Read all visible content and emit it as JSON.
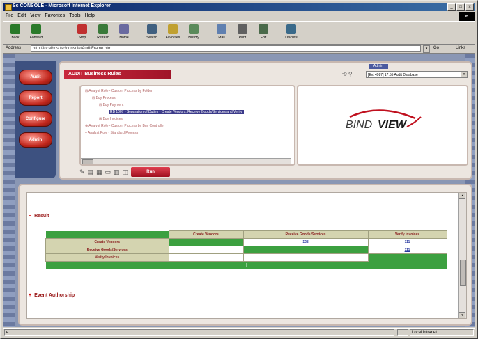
{
  "window": {
    "title": "Sc CONSOLE - Microsoft Internet Explorer",
    "minimize": "_",
    "maximize": "□",
    "close": "x"
  },
  "menu": [
    "File",
    "Edit",
    "View",
    "Favorites",
    "Tools",
    "Help"
  ],
  "throbber": "e",
  "toolbar": [
    {
      "label": "Back",
      "icon": "back-arrow-icon",
      "color": "#2a7a2a"
    },
    {
      "label": "Forward",
      "icon": "forward-arrow-icon",
      "color": "#2a7a2a"
    },
    {
      "label": "Stop",
      "icon": "stop-icon",
      "color": "#c03030"
    },
    {
      "label": "Refresh",
      "icon": "refresh-icon",
      "color": "#3a7a3a"
    },
    {
      "label": "Home",
      "icon": "home-icon",
      "color": "#6a6aa0"
    },
    {
      "label": "Search",
      "icon": "search-icon",
      "color": "#406080"
    },
    {
      "label": "Favorites",
      "icon": "favorites-icon",
      "color": "#c0a030"
    },
    {
      "label": "History",
      "icon": "history-icon",
      "color": "#5a8a5a"
    },
    {
      "label": "Mail",
      "icon": "mail-icon",
      "color": "#6080b0"
    },
    {
      "label": "Print",
      "icon": "print-icon",
      "color": "#606060"
    },
    {
      "label": "Edit",
      "icon": "edit-icon",
      "color": "#4a6a4a"
    },
    {
      "label": "Discuss",
      "icon": "discuss-icon",
      "color": "#3a6a8a"
    }
  ],
  "address": {
    "label": "Address",
    "value": "http://localhost/sc/console/AuditFrame.htm",
    "go": "Go",
    "links": "Links"
  },
  "nav": {
    "buttons": [
      "Audit",
      "Report",
      "Configure",
      "Admin"
    ]
  },
  "audit": {
    "title": "AUDIT Business Rules",
    "user_badge": "Admin",
    "session_value": "[Evt 4987] 17:55 Audit Database",
    "ctrl_icons": "⟲  ⚲"
  },
  "tree": {
    "lines": [
      "⊟  Analyst Role - Custom Process by Folder",
      "⊟  Buy Process",
      "⊟  Buy Payment",
      "RB 1007 - Separation of Duties - Create Vendors, Receive Goods/Services and Verify",
      "⊞  Buy Invoices",
      "⊕  Analyst Role - Custom Process by Buy Controller",
      "+  Analyst Role - Standard Process"
    ],
    "scroll_marker": "◂◂◂"
  },
  "logo": {
    "text_bind": "BIND",
    "text_view": "VIEW",
    "accent": "#c0101e"
  },
  "view_toolbar": {
    "icons": [
      "✎",
      "▤",
      "▦",
      "▭",
      "▥",
      "◫"
    ],
    "action_button": "Run"
  },
  "report": {
    "section1": "Result",
    "section1_toggle": "−",
    "section2": "Event Authorship",
    "section2_toggle": "+",
    "columns": [
      "",
      "Create Vendors",
      "Receive Goods/Services",
      "Verify Invoices"
    ],
    "rows": [
      {
        "label": "Create Vendors",
        "cells": [
          "green",
          "",
          "128",
          "111"
        ]
      },
      {
        "label": "Receive Goods/Services",
        "cells": [
          "blank",
          "",
          "green",
          "111"
        ]
      },
      {
        "label": "Verify Invoices",
        "cells": [
          "blank",
          "",
          "",
          "green"
        ]
      }
    ],
    "total_marker": "|"
  },
  "status": {
    "left": "e",
    "right": "Local intranet"
  }
}
